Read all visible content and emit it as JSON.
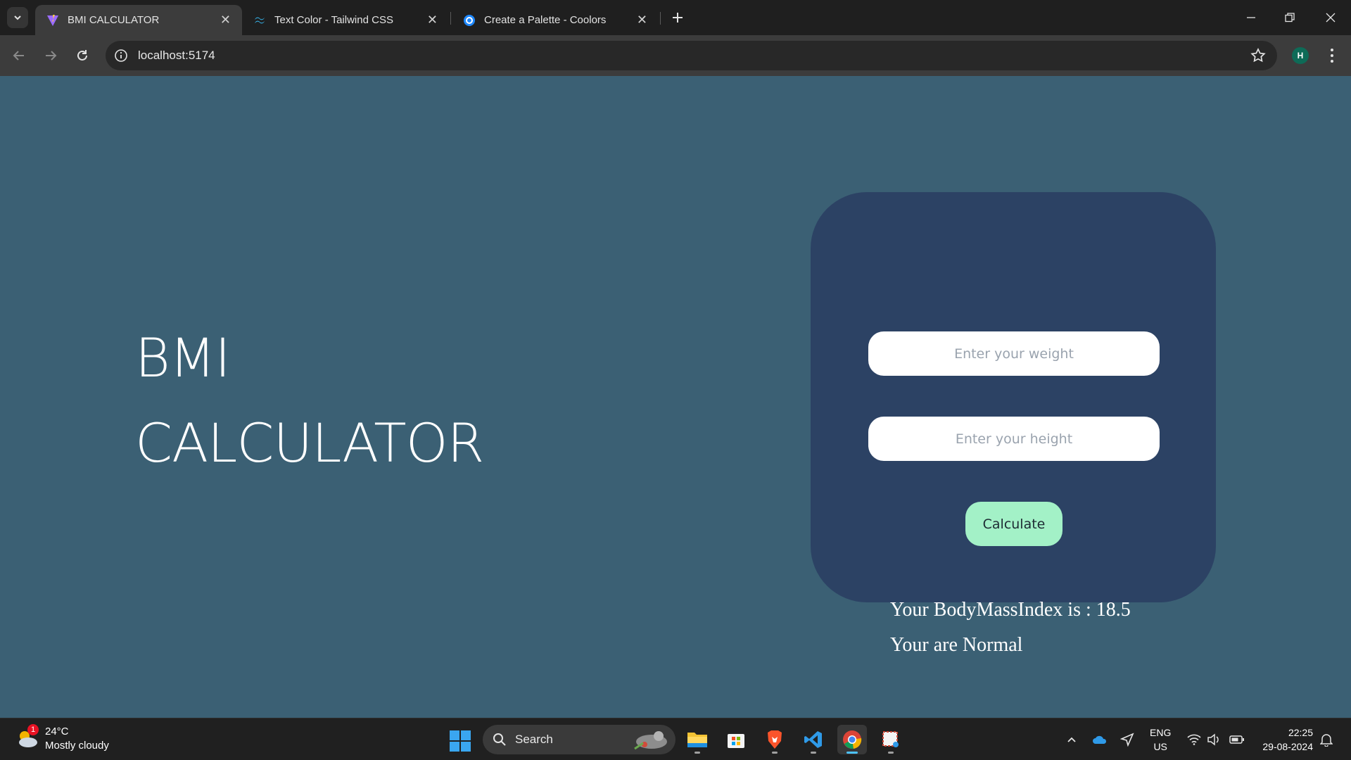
{
  "browser": {
    "tabs": [
      {
        "title": "BMI CALCULATOR",
        "icon": "vite-icon",
        "active": true
      },
      {
        "title": "Text Color - Tailwind CSS",
        "icon": "tailwind-icon",
        "active": false
      },
      {
        "title": "Create a Palette - Coolors",
        "icon": "coolors-icon",
        "active": false
      }
    ],
    "close_glyph": "✕",
    "url": "localhost:5174",
    "profile_initial": "H"
  },
  "page": {
    "hero": {
      "line1": "BMI",
      "line2": "CALCULATOR"
    },
    "form": {
      "weight_placeholder": "Enter your weight",
      "height_placeholder": "Enter your height",
      "button_label": "Calculate"
    },
    "result": {
      "bmi_text": "Your BodyMassIndex is : 18.5",
      "status_text": "Your are Normal"
    }
  },
  "taskbar": {
    "weather": {
      "temp": "24°C",
      "condition": "Mostly cloudy",
      "badge": "1"
    },
    "search_label": "Search",
    "lang": {
      "line1": "ENG",
      "line2": "US"
    },
    "clock": {
      "time": "22:25",
      "date": "29-08-2024"
    },
    "apps": [
      "file-explorer-icon",
      "microsoft-store-icon",
      "brave-icon",
      "vscode-icon",
      "chrome-icon",
      "snipping-tool-icon"
    ]
  },
  "colors": {
    "page_bg": "#3b6074",
    "card_bg": "#2c4264",
    "button_bg": "#a3f1c7"
  }
}
